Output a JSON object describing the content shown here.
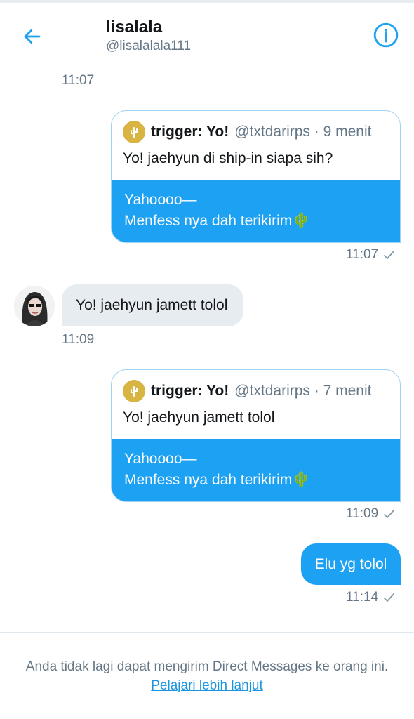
{
  "colors": {
    "accent": "#1da1f2",
    "secondary_text": "#657786",
    "received_bubble": "#e6ecf0"
  },
  "header": {
    "display_name": "lisalala__",
    "handle": "@lisalalala111",
    "back_icon": "arrow-left-icon",
    "info_icon": "info-circle-icon"
  },
  "messages": {
    "m0": {
      "time": "11:07"
    },
    "m1": {
      "card_name": "trigger: Yo!",
      "card_meta": "@txtdarirps · 9 menit",
      "card_text": "Yo! jaehyun di ship-in siapa sih?",
      "reply_line1": "Yahoooo—",
      "reply_line2": "Menfess nya dah terikirim🌵",
      "time": "11:07"
    },
    "m2": {
      "text": "Yo! jaehyun jamett tolol",
      "time": "11:09"
    },
    "m3": {
      "card_name": "trigger: Yo!",
      "card_meta": "@txtdarirps · 7 menit",
      "card_text": "Yo! jaehyun jamett tolol",
      "reply_line1": "Yahoooo—",
      "reply_line2": "Menfess nya dah terikirim🌵",
      "time": "11:09"
    },
    "m4": {
      "text": "Elu yg tolol",
      "time": "11:14"
    }
  },
  "footer": {
    "notice": "Anda tidak lagi dapat mengirim Direct Messages ke orang ini.",
    "link": "Pelajari lebih lanjut"
  }
}
